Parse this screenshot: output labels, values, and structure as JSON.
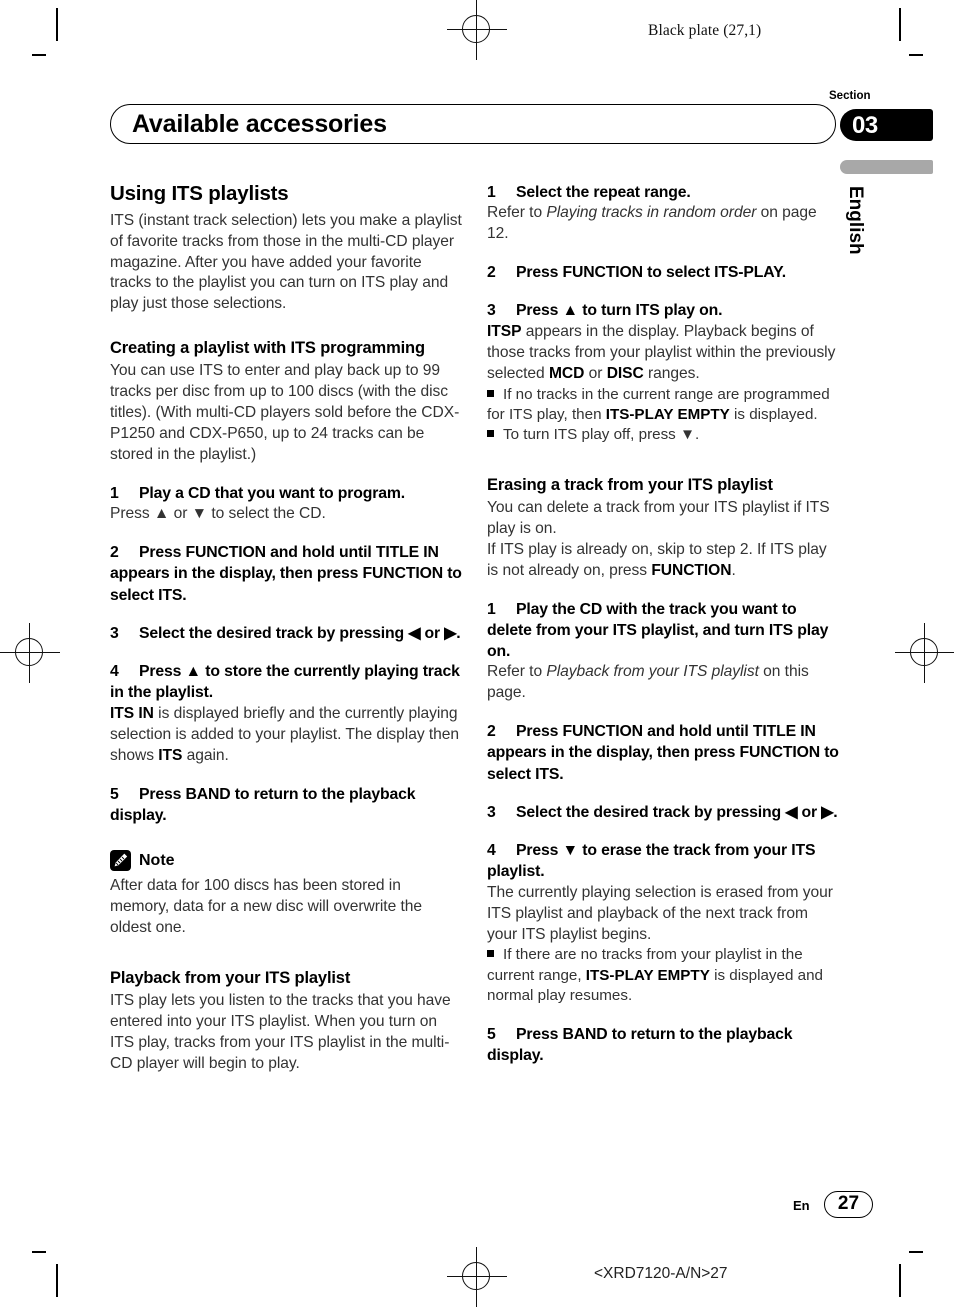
{
  "page": {
    "header_note": "Black plate (27,1)",
    "footer_code": "<XRD7120-A/N>27",
    "section_label": "Section",
    "section_number": "03",
    "language_tab": "English",
    "banner_title": "Available accessories",
    "footer_lang": "En",
    "page_number": "27",
    "colors": {
      "text": "#333333",
      "heading": "#000000",
      "lang_bar": "#a8a8a8",
      "section_box": "#000000"
    }
  },
  "left_column": {
    "heading": "Using ITS playlists",
    "intro": "ITS (instant track selection) lets you make a playlist of favorite tracks from those in the multi-CD player magazine. After you have added your favorite tracks to the playlist you can turn on ITS play and play just those selections.",
    "creating": {
      "heading": "Creating a playlist with ITS programming",
      "body": "You can use ITS to enter and play back up to 99 tracks per disc from up to 100 discs (with the disc titles). (With multi-CD players sold before the CDX-P1250 and CDX-P650, up to 24 tracks can be stored in the playlist.)",
      "steps": [
        {
          "num": "1",
          "text": "Play a CD that you want to program.",
          "detail_prefix": "Press ",
          "detail_up": "▲",
          "detail_mid": " or ",
          "detail_down": "▼",
          "detail_suffix": " to select the CD."
        },
        {
          "num": "2",
          "text": "Press FUNCTION and hold until TITLE IN appears in the display, then press FUNCTION to select ITS."
        },
        {
          "num": "3",
          "text_a": "Select the desired track by pressing ",
          "arrow_left": "◀",
          "text_b": " or ",
          "arrow_right": "▶",
          "text_c": "."
        },
        {
          "num": "4",
          "text_a": "Press ",
          "arrow_up": "▲",
          "text_b": " to store the currently playing track in the playlist.",
          "detail_b1": "ITS IN",
          "detail_1": " is displayed briefly and the currently playing selection is added to your playlist. The display then shows ",
          "detail_b2": "ITS",
          "detail_2": " again."
        },
        {
          "num": "5",
          "text": "Press BAND to return to the playback display."
        }
      ]
    },
    "note": {
      "label": "Note",
      "icon": "pencil-icon",
      "body": "After data for 100 discs has been stored in memory, data for a new disc will overwrite the oldest one."
    },
    "playback": {
      "heading": "Playback from your ITS playlist",
      "body": "ITS play lets you listen to the tracks that you have entered into your ITS playlist. When you turn on ITS play, tracks from your ITS playlist in the multi-CD player will begin to play."
    }
  },
  "right_column": {
    "playback_steps": [
      {
        "num": "1",
        "text": "Select the repeat range.",
        "detail_prefix": "Refer to ",
        "detail_italic": "Playing tracks in random order",
        "detail_suffix": " on page 12."
      },
      {
        "num": "2",
        "text": "Press FUNCTION to select ITS-PLAY."
      },
      {
        "num": "3",
        "text_a": "Press ",
        "arrow_up": "▲",
        "text_b": " to turn ITS play on.",
        "detail_b1": "ITSP",
        "detail_1": " appears in the display. Playback begins of those tracks from your playlist within the previously selected ",
        "detail_b2": "MCD",
        "detail_2": " or ",
        "detail_b3": "DISC",
        "detail_3": " ranges."
      }
    ],
    "playback_bullets": [
      {
        "text_a": "If no tracks in the current range are programmed for ITS play, then ",
        "bold": "ITS-PLAY EMPTY",
        "text_b": " is displayed."
      },
      {
        "text_a": "To turn ITS play off, press ",
        "arrow_down": "▼",
        "text_b": "."
      }
    ],
    "erasing": {
      "heading": "Erasing a track from your ITS playlist",
      "body_1": "You can delete a track from your ITS playlist if ITS play is on.",
      "body_2a": "If ITS play is already on, skip to step 2. If ITS play is not already on, press ",
      "body_2b": "FUNCTION",
      "body_2c": ".",
      "steps": [
        {
          "num": "1",
          "text": "Play the CD with the track you want to delete from your ITS playlist, and turn ITS play on.",
          "detail_prefix": "Refer to ",
          "detail_italic": "Playback from your ITS playlist",
          "detail_suffix": " on this page."
        },
        {
          "num": "2",
          "text": "Press FUNCTION and hold until TITLE IN appears in the display, then press FUNCTION to select ITS."
        },
        {
          "num": "3",
          "text_a": "Select the desired track by pressing ",
          "arrow_left": "◀",
          "text_b": " or ",
          "arrow_right": "▶",
          "text_c": "."
        },
        {
          "num": "4",
          "text_a": "Press ",
          "arrow_down": "▼",
          "text_b": " to erase the track from your ITS playlist.",
          "detail": "The currently playing selection is erased from your ITS playlist and playback of the next track from your ITS playlist begins."
        },
        {
          "num": "5",
          "text": "Press BAND to return to the playback display."
        }
      ],
      "bullet": {
        "text_a": "If there are no tracks from your playlist in the current range, ",
        "bold": "ITS-PLAY EMPTY",
        "text_b": " is displayed and normal play resumes."
      }
    }
  }
}
